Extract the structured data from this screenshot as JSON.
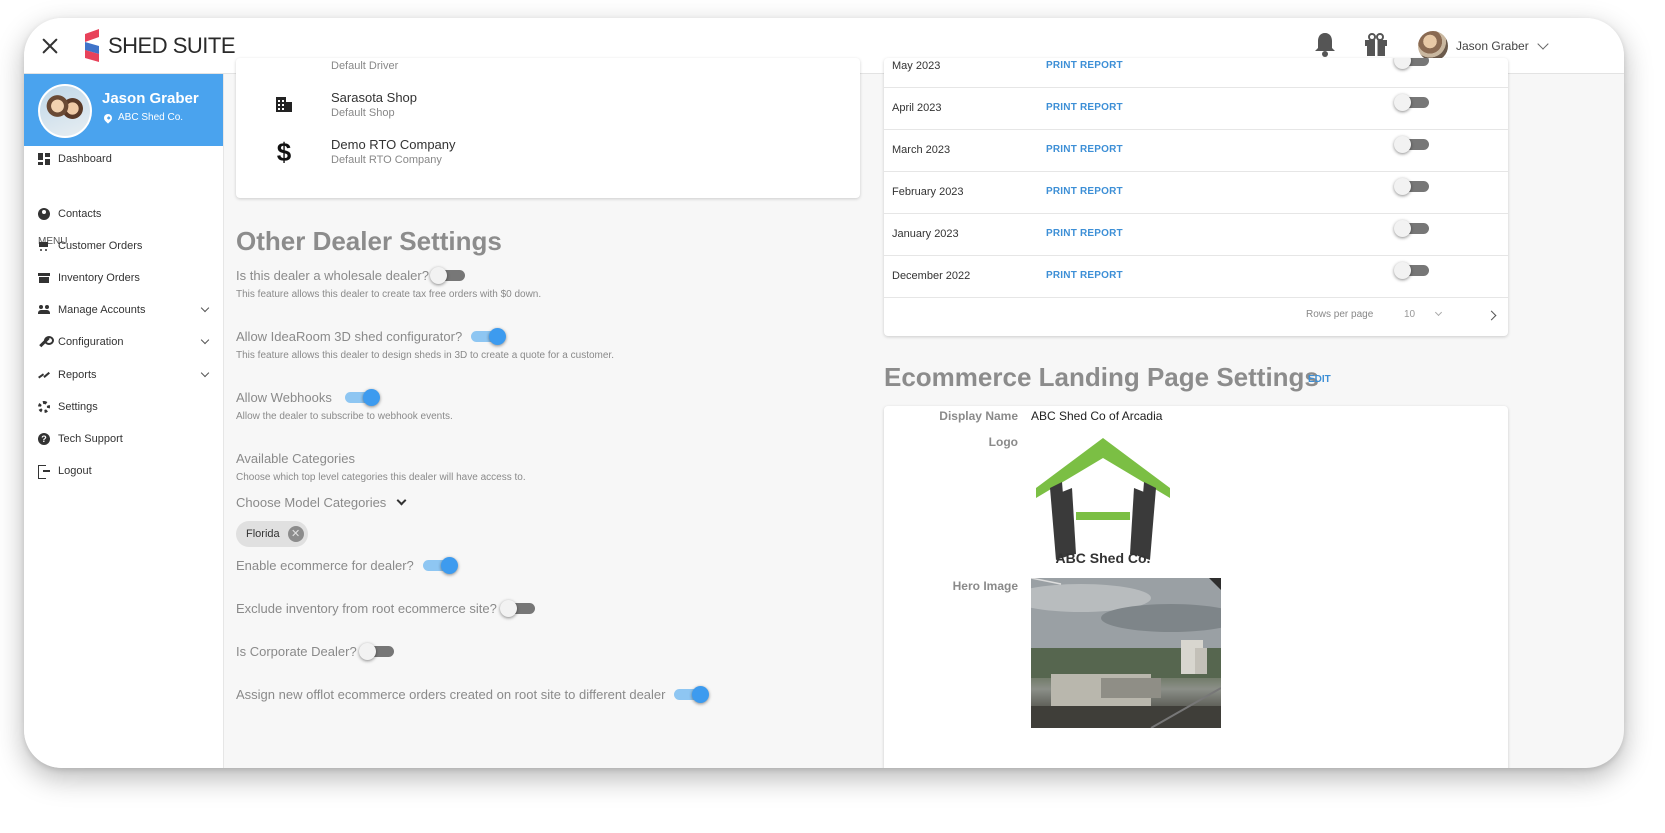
{
  "app": {
    "brand": "SHED SUITE"
  },
  "topbar": {
    "user_name": "Jason Graber"
  },
  "sidebar": {
    "profile_name": "Jason Graber",
    "profile_company": "ABC Shed Co.",
    "menu_label": "MENU",
    "items": [
      {
        "label": "Dashboard",
        "icon": "dashboard-icon"
      },
      {
        "label": "Contacts",
        "icon": "account-circle-icon"
      },
      {
        "label": "Customer Orders",
        "icon": "cart-icon"
      },
      {
        "label": "Inventory Orders",
        "icon": "store-icon"
      },
      {
        "label": "Manage Accounts",
        "icon": "people-icon"
      },
      {
        "label": "Configuration",
        "icon": "wrench-icon"
      },
      {
        "label": "Reports",
        "icon": "trending-icon"
      },
      {
        "label": "Settings",
        "icon": "gear-icon"
      },
      {
        "label": "Tech Support",
        "icon": "help-icon"
      },
      {
        "label": "Logout",
        "icon": "logout-icon"
      }
    ]
  },
  "defaults": {
    "partial_top": "Default Driver",
    "items": [
      {
        "title": "Sarasota Shop",
        "subtitle": "Default Shop",
        "icon": "building-icon"
      },
      {
        "title": "Demo RTO Company",
        "subtitle": "Default RTO Company",
        "icon": "dollar-icon"
      }
    ]
  },
  "other_settings": {
    "title": "Other Dealer Settings",
    "wholesale_label": "Is this dealer a wholesale dealer?",
    "wholesale_desc": "This feature allows this dealer to create tax free orders with $0 down.",
    "wholesale_on": false,
    "idearoom_label": "Allow IdeaRoom 3D shed configurator?",
    "idearoom_desc": "This feature allows this dealer to design sheds in 3D to create a quote for a customer.",
    "idearoom_on": true,
    "webhooks_label": "Allow Webhooks",
    "webhooks_desc": "Allow the dealer to subscribe to webhook events.",
    "webhooks_on": true,
    "categories_label": "Available Categories",
    "categories_desc": "Choose which top level categories this dealer will have access to.",
    "choose_label": "Choose Model Categories",
    "chip": "Florida",
    "ecommerce_label": "Enable ecommerce for dealer?",
    "ecommerce_on": true,
    "exclude_label": "Exclude inventory from root ecommerce site?",
    "exclude_on": false,
    "corporate_label": "Is Corporate Dealer?",
    "corporate_on": false,
    "offlot_label": "Assign new offlot ecommerce orders created on root site to different dealer",
    "offlot_on": true
  },
  "reports": {
    "link_label": "PRINT REPORT",
    "rows": [
      {
        "month": "May 2023",
        "on": false
      },
      {
        "month": "April 2023",
        "on": false
      },
      {
        "month": "March 2023",
        "on": false
      },
      {
        "month": "February 2023",
        "on": false
      },
      {
        "month": "January 2023",
        "on": false
      },
      {
        "month": "December 2022",
        "on": false
      }
    ],
    "rows_per_page_label": "Rows per page",
    "rows_per_page": "10"
  },
  "ecommerce": {
    "title": "Ecommerce Landing Page Settings",
    "edit_label": "EDIT",
    "display_name_key": "Display Name",
    "display_name": "ABC Shed Co of Arcadia",
    "logo_key": "Logo",
    "logo_text": "ABC Shed Co.",
    "hero_key": "Hero Image"
  },
  "colors": {
    "accent": "#3d9bef",
    "profile_bg": "#4aa3ee",
    "logo_green": "#7bbf44",
    "logo_dark": "#3a3a3a",
    "link": "#3d8fd6"
  }
}
